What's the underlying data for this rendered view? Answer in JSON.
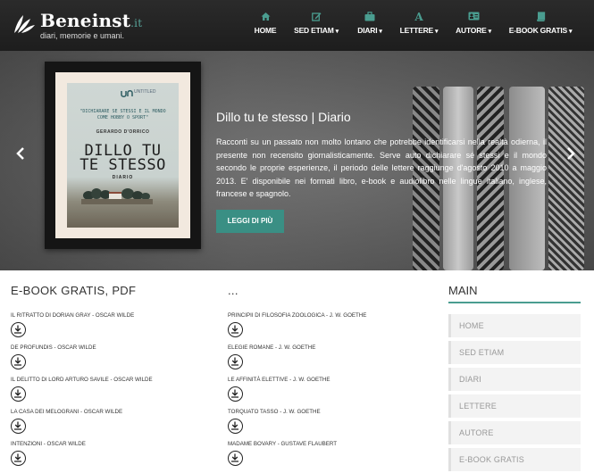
{
  "header": {
    "logo_title": "Beneinst",
    "logo_tld": ".it",
    "logo_tagline": "diari, memorie e umani."
  },
  "nav": [
    {
      "label": "HOME",
      "icon": "home-icon",
      "dropdown": false
    },
    {
      "label": "SED ETIAM",
      "icon": "edit-icon",
      "dropdown": true
    },
    {
      "label": "DIARI",
      "icon": "briefcase-icon",
      "dropdown": true
    },
    {
      "label": "LETTERE",
      "icon": "font-icon",
      "dropdown": true
    },
    {
      "label": "AUTORE",
      "icon": "id-card-icon",
      "dropdown": true
    },
    {
      "label": "E-BOOK GRATIS",
      "icon": "book-icon",
      "dropdown": true
    }
  ],
  "slide": {
    "title": "Dillo tu te stesso | Diario",
    "text": "Racconti su un passato non molto lontano che potrebbe identificarsi nella realtà odierna, il presente non recensito giornalisticamente. Serve auto dichiarare sé stessi e il mondo secondo le proprie esperienze, il periodo delle lettere raggiunge d'agosto 2010 a maggio 2013. E' disponibile nei formati libro, e-book e audiolibro nelle lingue italiano, inglese, francese e spagnolo.",
    "button": "LEGGI DI PIÙ",
    "cover": {
      "publisher": "UNTITLED",
      "quote": "\"DICHIARARE SE STESSI E IL MONDO COME HOBBY O SPORT\"",
      "author": "GERARDO D'ORRICO",
      "title_line1": "DILLO TU",
      "title_line2": "TE STESSO",
      "subtitle": "DIARIO"
    }
  },
  "col1": {
    "title": "E-BOOK GRATIS, PDF",
    "books": [
      "IL RITRATTO DI DORIAN GRAY - OSCAR WILDE",
      "DE PROFUNDIS - OSCAR WILDE",
      "IL DELITTO DI LORD ARTURO SAVILE - OSCAR WILDE",
      "LA CASA DEI MELOGRANI - OSCAR WILDE",
      "INTENZIONI - OSCAR WILDE"
    ]
  },
  "col2": {
    "title": "...",
    "books": [
      "PRINCIPII DI FILOSOFIA ZOOLOGICA - J. W. GOETHE",
      "ELEGIE ROMANE - J. W. GOETHE",
      "LE AFFINITÀ ELETTIVE - J. W. GOETHE",
      "TORQUATO TASSO - J. W. GOETHE",
      "MADAME BOVARY - GUSTAVE FLAUBERT"
    ]
  },
  "sidebar": {
    "title": "MAIN",
    "items": [
      "HOME",
      "SED ETIAM",
      "DIARI",
      "LETTERE",
      "AUTORE",
      "E-BOOK GRATIS"
    ]
  },
  "colors": {
    "accent": "#4a9d90",
    "button": "#3a8f84",
    "header": "#222222"
  }
}
